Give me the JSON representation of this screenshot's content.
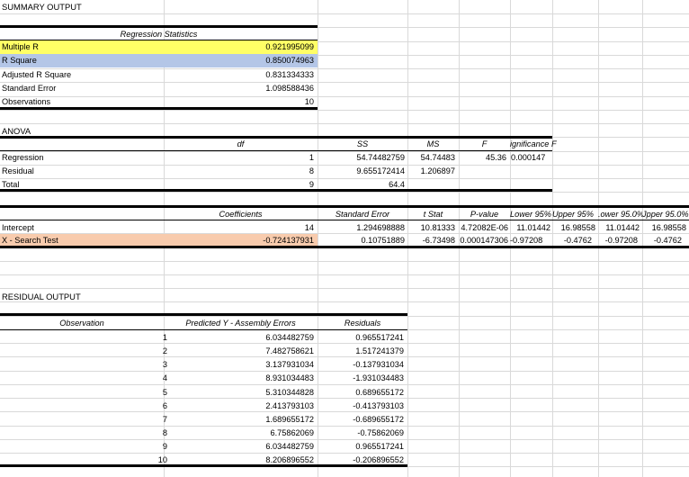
{
  "summary_title": "SUMMARY OUTPUT",
  "regression_statistics": {
    "header": "Regression Statistics",
    "rows": [
      {
        "label": "Multiple R",
        "value": "0.921995099"
      },
      {
        "label": "R Square",
        "value": "0.850074963"
      },
      {
        "label": "Adjusted R Square",
        "value": "0.831334333"
      },
      {
        "label": "Standard Error",
        "value": "1.098588436"
      },
      {
        "label": "Observations",
        "value": "10"
      }
    ]
  },
  "anova": {
    "title": "ANOVA",
    "headers": [
      "df",
      "SS",
      "MS",
      "F",
      "ignificance F"
    ],
    "rows": [
      {
        "label": "Regression",
        "df": "1",
        "ss": "54.74482759",
        "ms": "54.74483",
        "f": "45.36",
        "sig": "0.000147"
      },
      {
        "label": "Residual",
        "df": "8",
        "ss": "9.655172414",
        "ms": "1.206897",
        "f": "",
        "sig": ""
      },
      {
        "label": "Total",
        "df": "9",
        "ss": "64.4",
        "ms": "",
        "f": "",
        "sig": ""
      }
    ]
  },
  "coefficients": {
    "headers": [
      "Coefficients",
      "Standard Error",
      "t Stat",
      "P-value",
      "Lower 95%",
      "Upper 95%",
      ".ower 95.0%",
      "Jpper 95.0%"
    ],
    "rows": [
      {
        "label": "Intercept",
        "values": [
          "14",
          "1.294698888",
          "10.81333",
          "4.72082E-06",
          "11.01442",
          "16.98558",
          "11.01442",
          "16.98558"
        ]
      },
      {
        "label": "X - Search Test",
        "values": [
          "-0.724137931",
          "0.10751889",
          "-6.73498",
          "0.000147306",
          "-0.97208",
          "-0.4762",
          "-0.97208",
          "-0.4762"
        ]
      }
    ]
  },
  "residual_output": {
    "title": "RESIDUAL OUTPUT",
    "headers": [
      "Observation",
      "Predicted Y - Assembly Errors",
      "Residuals"
    ],
    "rows": [
      [
        "1",
        "6.034482759",
        "0.965517241"
      ],
      [
        "2",
        "7.482758621",
        "1.517241379"
      ],
      [
        "3",
        "3.137931034",
        "-0.137931034"
      ],
      [
        "4",
        "8.931034483",
        "-1.931034483"
      ],
      [
        "5",
        "5.310344828",
        "0.689655172"
      ],
      [
        "6",
        "2.413793103",
        "-0.413793103"
      ],
      [
        "7",
        "1.689655172",
        "-0.689655172"
      ],
      [
        "8",
        "6.75862069",
        "-0.75862069"
      ],
      [
        "9",
        "6.034482759",
        "0.965517241"
      ],
      [
        "10",
        "8.206896552",
        "-0.206896552"
      ]
    ]
  },
  "colors": {
    "highlight_yellow": "#ffff66",
    "highlight_blue": "#b4c6e7",
    "highlight_peach": "#f8cbad",
    "gridline": "#d9d9d9"
  }
}
